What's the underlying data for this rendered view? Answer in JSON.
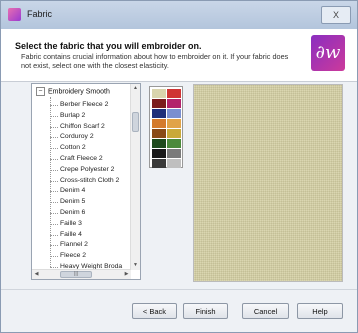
{
  "window": {
    "title": "Fabric",
    "close_label": "X"
  },
  "header": {
    "heading": "Select the fabric that you will embroider on.",
    "description": "Fabric contains crucial information about how to embroider on it. If your fabric does not exist, select one with the closest elasticity.",
    "logo_text": "∂w"
  },
  "tree": {
    "expander": "–",
    "root": "Embroidery Smooth",
    "items": [
      "Berber Fleece 2",
      "Burlap 2",
      "Chiffon Scarf 2",
      "Corduroy 2",
      "Cotton 2",
      "Craft Fleece 2",
      "Crepe Polyester 2",
      "Cross-stitch Cloth 2",
      "Denim 4",
      "Denim 5",
      "Denim 6",
      "Faille 3",
      "Faille 4",
      "Flannel 2",
      "Fleece 2",
      "Heavy Weight Broda"
    ],
    "scroll_thumb": "|||"
  },
  "swatches": [
    "#d9d4ad",
    "#cf3434",
    "#7b1d1d",
    "#b3236b",
    "#1f2f7a",
    "#7a8fd0",
    "#d47a2c",
    "#e1a348",
    "#8a4a17",
    "#c9a93a",
    "#1e4a1c",
    "#4b8a3b",
    "#1a1a1a",
    "#7b7b7b",
    "#3a3a3a",
    "#bfbfbf"
  ],
  "preview_color": "#d4cfa3",
  "buttons": {
    "back": "< Back",
    "finish": "Finish",
    "cancel": "Cancel",
    "help": "Help"
  }
}
